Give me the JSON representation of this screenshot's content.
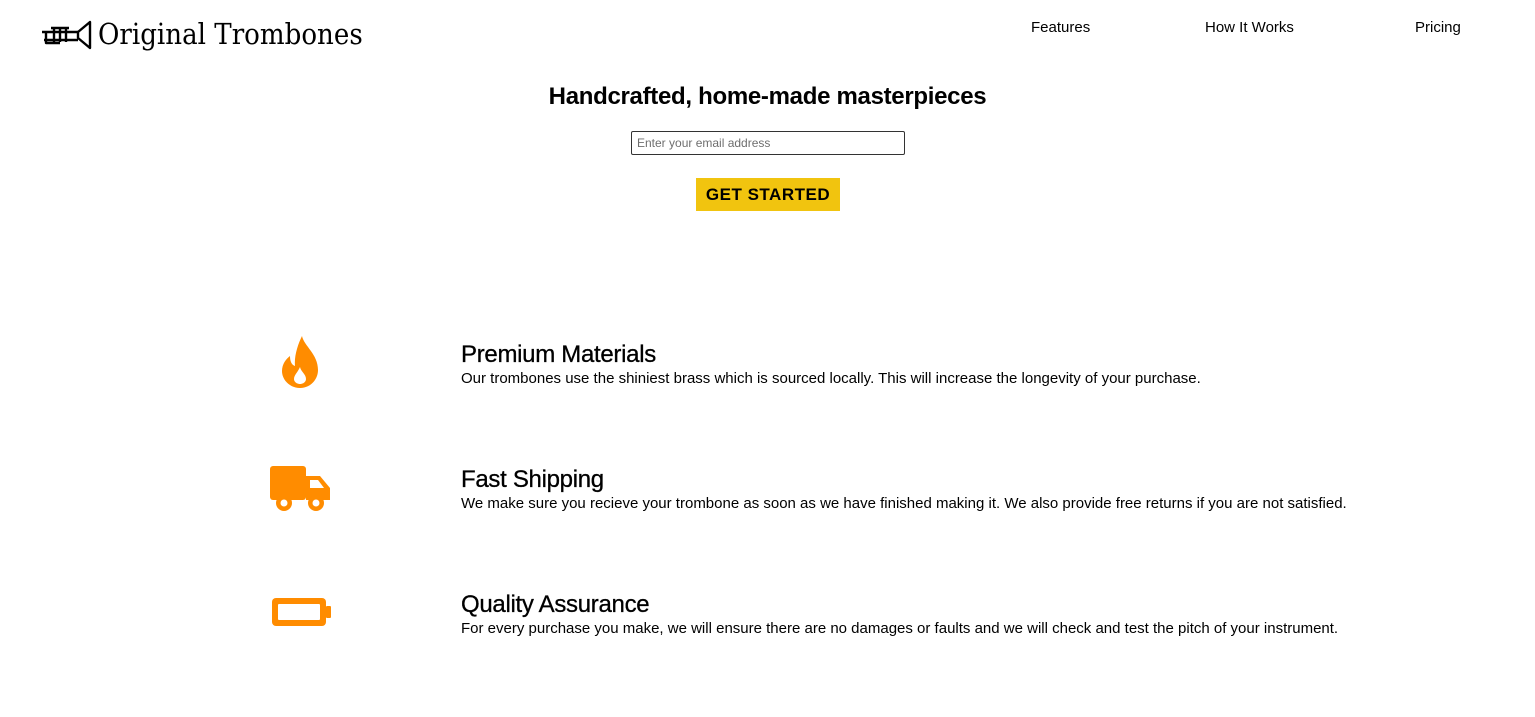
{
  "brand": {
    "name": "Original Trombones",
    "logo_icon": "trombone-icon"
  },
  "nav": {
    "items": [
      {
        "label": "Features"
      },
      {
        "label": "How It Works"
      },
      {
        "label": "Pricing"
      }
    ]
  },
  "hero": {
    "title": "Handcrafted, home-made masterpieces",
    "email_placeholder": "Enter your email address",
    "email_value": "",
    "cta_label": "GET STARTED"
  },
  "colors": {
    "accent_orange": "#ff8c00",
    "cta_yellow": "#f1c40f"
  },
  "features": [
    {
      "icon": "fire-icon",
      "title": "Premium Materials",
      "description": "Our trombones use the shiniest brass which is sourced locally. This will increase the longevity of your purchase."
    },
    {
      "icon": "truck-icon",
      "title": "Fast Shipping",
      "description": "We make sure you recieve your trombone as soon as we have finished making it. We also provide free returns if you are not satisfied."
    },
    {
      "icon": "battery-icon",
      "title": "Quality Assurance",
      "description": "For every purchase you make, we will ensure there are no damages or faults and we will check and test the pitch of your instrument."
    }
  ]
}
